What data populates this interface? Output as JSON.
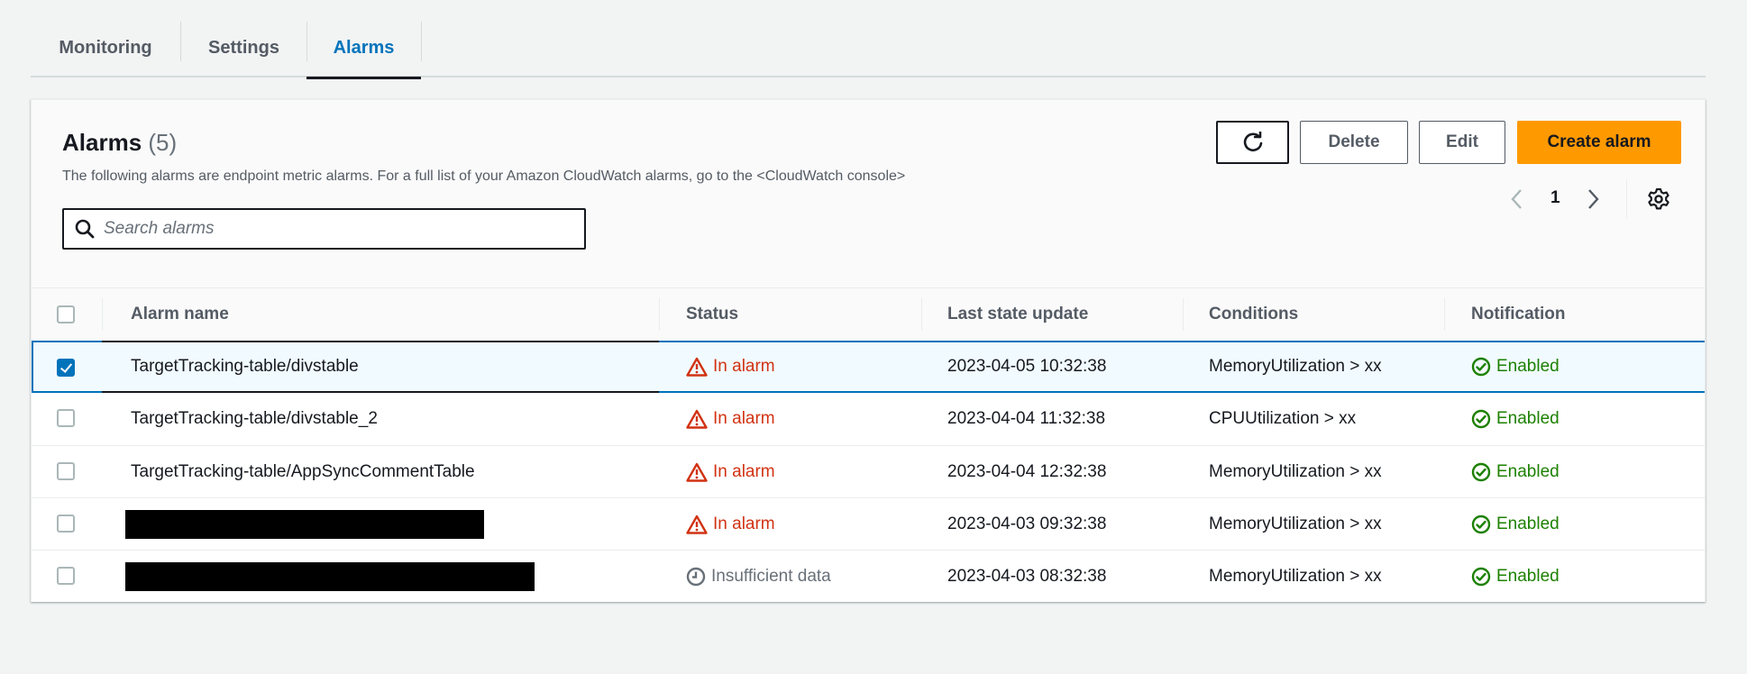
{
  "tabs": [
    {
      "label": "Monitoring",
      "active": false
    },
    {
      "label": "Settings",
      "active": false
    },
    {
      "label": "Alarms",
      "active": true
    }
  ],
  "panel": {
    "title": "Alarms",
    "count": "(5)",
    "description": "The following alarms are endpoint metric alarms. For a full list of your Amazon CloudWatch alarms, go to the <CloudWatch console>",
    "search_placeholder": "Search alarms",
    "search_value": "",
    "buttons": {
      "refresh_icon": "refresh-icon",
      "delete": "Delete",
      "edit": "Edit",
      "create": "Create alarm"
    },
    "pagination": {
      "current_page": "1",
      "prev_icon": "chevron-left-icon",
      "next_icon": "chevron-right-icon",
      "settings_icon": "gear-icon"
    }
  },
  "table": {
    "columns": [
      "Alarm name",
      "Status",
      "Last state update",
      "Conditions",
      "Notification"
    ],
    "rows": [
      {
        "selected": true,
        "name": "TargetTracking-table/divstable",
        "redacted": false,
        "status": "In alarm",
        "status_type": "alarm",
        "last_update": "2023-04-05 10:32:38",
        "conditions": "MemoryUtilization > xx",
        "notification": "Enabled"
      },
      {
        "selected": false,
        "name": "TargetTracking-table/divstable_2",
        "redacted": false,
        "status": "In alarm",
        "status_type": "alarm",
        "last_update": "2023-04-04 11:32:38",
        "conditions": "CPUUtilization > xx",
        "notification": "Enabled"
      },
      {
        "selected": false,
        "name": "TargetTracking-table/AppSyncCommentTable",
        "redacted": false,
        "status": "In alarm",
        "status_type": "alarm",
        "last_update": "2023-04-04 12:32:38",
        "conditions": "MemoryUtilization > xx",
        "notification": "Enabled"
      },
      {
        "selected": false,
        "name": "",
        "redacted": true,
        "status": "In alarm",
        "status_type": "alarm",
        "last_update": "2023-04-03 09:32:38",
        "conditions": "MemoryUtilization > xx",
        "notification": "Enabled"
      },
      {
        "selected": false,
        "name": "",
        "redacted": true,
        "status": "Insufficient data",
        "status_type": "insufficient",
        "last_update": "2023-04-03 08:32:38",
        "conditions": "MemoryUtilization > xx",
        "notification": "Enabled"
      }
    ]
  },
  "colors": {
    "accent": "#0073bb",
    "primary_button": "#ff9900",
    "alarm": "#d13212",
    "enabled": "#1d8102",
    "insufficient": "#687078"
  }
}
